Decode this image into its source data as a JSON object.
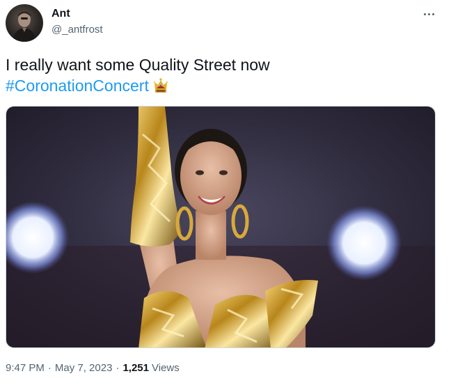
{
  "author": {
    "display_name": "Ant",
    "handle": "@_antfrost",
    "avatar_icon": "profile-photo"
  },
  "tweet": {
    "text": "I really want some Quality Street now",
    "hashtag": "#CoronationConcert",
    "emoji_icon": "crown-icon",
    "media_icon": "concert-photo"
  },
  "meta": {
    "time": "9:47 PM",
    "date": "May 7, 2023",
    "views_count": "1,251",
    "views_label": "Views",
    "separator": "·"
  },
  "colors": {
    "text": "#0f1419",
    "secondary": "#536471",
    "link": "#1d9bf0",
    "background": "#ffffff"
  }
}
